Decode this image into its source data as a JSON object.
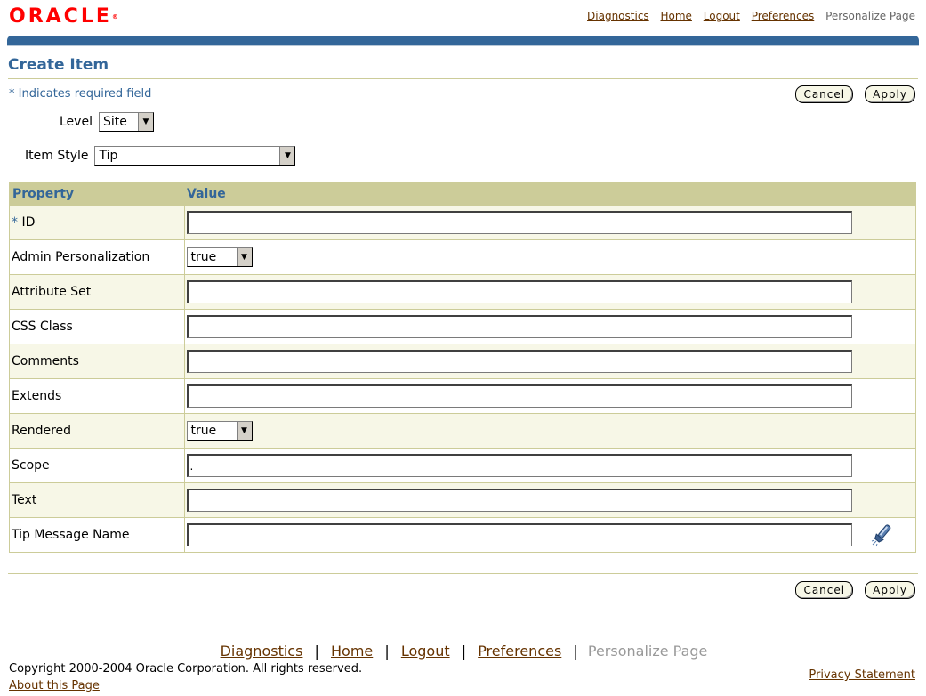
{
  "brand": {
    "logo_text": "ORACLE",
    "logo_mark": "®"
  },
  "global_links": {
    "diagnostics": "Diagnostics",
    "home": "Home",
    "logout": "Logout",
    "preferences": "Preferences",
    "personalize": "Personalize Page"
  },
  "page": {
    "title": "Create Item",
    "required_star": "*",
    "required_note": "Indicates required field"
  },
  "buttons": {
    "cancel": "Cancel",
    "apply": "Apply"
  },
  "form": {
    "level_label": "Level",
    "level_value": "Site",
    "item_style_label": "Item Style",
    "item_style_value": "Tip"
  },
  "table": {
    "headers": {
      "property": "Property",
      "value": "Value"
    },
    "rows": [
      {
        "label": "ID",
        "required": true,
        "type": "text",
        "value": ""
      },
      {
        "label": "Admin Personalization",
        "type": "select",
        "value": "true"
      },
      {
        "label": "Attribute Set",
        "type": "text",
        "value": ""
      },
      {
        "label": "CSS Class",
        "type": "text",
        "value": ""
      },
      {
        "label": "Comments",
        "type": "text",
        "value": ""
      },
      {
        "label": "Extends",
        "type": "text",
        "value": ""
      },
      {
        "label": "Rendered",
        "type": "select",
        "value": "true"
      },
      {
        "label": "Scope",
        "type": "text",
        "value": "."
      },
      {
        "label": "Text",
        "type": "text",
        "value": ""
      },
      {
        "label": "Tip Message Name",
        "type": "text-lov",
        "value": "",
        "icon": "flashlight-search-icon"
      }
    ]
  },
  "footer": {
    "links": {
      "diagnostics": "Diagnostics",
      "home": "Home",
      "logout": "Logout",
      "preferences": "Preferences",
      "personalize": "Personalize Page"
    },
    "separator": "|",
    "copyright": "Copyright 2000-2004 Oracle Corporation. All rights reserved.",
    "about": "About this Page",
    "privacy": "Privacy Statement"
  },
  "colors": {
    "brand_red": "#ff0000",
    "header_blue": "#336699",
    "table_header_bg": "#cccc99",
    "alt_row_bg": "#f7f7e7",
    "link_brown": "#663300"
  }
}
